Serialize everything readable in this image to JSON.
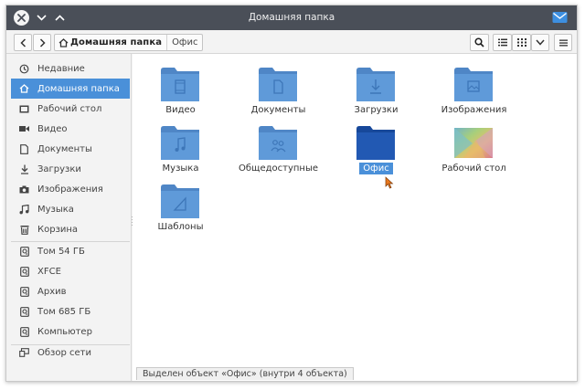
{
  "window": {
    "title": "Домашняя папка"
  },
  "toolbar": {
    "breadcrumb": [
      "Домашняя папка",
      "Офис"
    ]
  },
  "sidebar": {
    "items": [
      {
        "label": "Недавние",
        "icon": "recent-icon",
        "active": false
      },
      {
        "label": "Домашняя папка",
        "icon": "home-icon",
        "active": true
      },
      {
        "label": "Рабочий стол",
        "icon": "desktop-icon",
        "active": false
      },
      {
        "label": "Видео",
        "icon": "video-icon",
        "active": false
      },
      {
        "label": "Документы",
        "icon": "document-icon",
        "active": false
      },
      {
        "label": "Загрузки",
        "icon": "download-icon",
        "active": false
      },
      {
        "label": "Изображения",
        "icon": "camera-icon",
        "active": false
      },
      {
        "label": "Музыка",
        "icon": "music-icon",
        "active": false
      },
      {
        "label": "Корзина",
        "icon": "trash-icon",
        "active": false
      },
      {
        "label": "Том 54 ГБ",
        "icon": "drive-icon",
        "active": false
      },
      {
        "label": "XFCE",
        "icon": "drive-icon",
        "active": false
      },
      {
        "label": "Архив",
        "icon": "drive-icon",
        "active": false
      },
      {
        "label": "Том 685 ГБ",
        "icon": "drive-icon",
        "active": false
      },
      {
        "label": "Компьютер",
        "icon": "drive-icon",
        "active": false
      },
      {
        "label": "Обзор сети",
        "icon": "network-icon",
        "active": false
      }
    ]
  },
  "files": [
    {
      "name": "Видео",
      "icon": "folder-video-icon"
    },
    {
      "name": "Документы",
      "icon": "folder-documents-icon"
    },
    {
      "name": "Загрузки",
      "icon": "folder-download-icon"
    },
    {
      "name": "Изображения",
      "icon": "folder-pictures-icon"
    },
    {
      "name": "Музыка",
      "icon": "folder-music-icon"
    },
    {
      "name": "Общедоступные",
      "icon": "folder-public-icon"
    },
    {
      "name": "Офис",
      "icon": "folder-icon",
      "selected": true
    },
    {
      "name": "Рабочий стол",
      "icon": "desktop-wallpaper-icon"
    },
    {
      "name": "Шаблоны",
      "icon": "folder-templates-icon"
    }
  ],
  "status": "Выделен объект «Офис» (внутри 4 объекта)",
  "colors": {
    "titlebar": "#4a4f58",
    "accent": "#4a90d9",
    "folder": "#5a94d6",
    "folder_selected": "#1f55a8"
  }
}
